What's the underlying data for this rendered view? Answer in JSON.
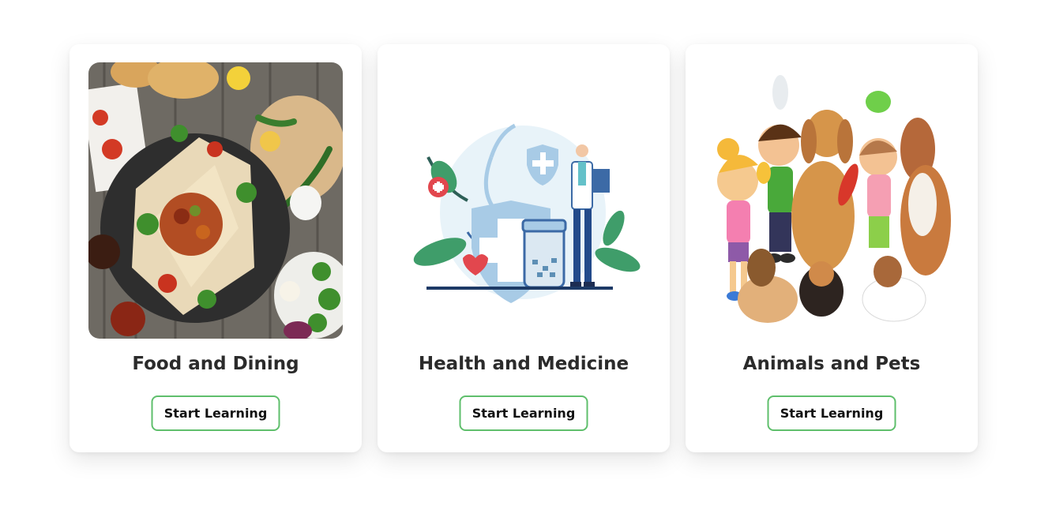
{
  "cards": [
    {
      "title": "Food and Dining",
      "button_label": "Start Learning",
      "image": "food-platter-image"
    },
    {
      "title": "Health and Medicine",
      "button_label": "Start Learning",
      "image": "health-medicine-illustration"
    },
    {
      "title": "Animals and Pets",
      "button_label": "Start Learning",
      "image": "children-with-pets-illustration"
    }
  ],
  "colors": {
    "button_border": "#5fbf6c",
    "title_text": "#2b2b2b",
    "card_background": "#ffffff"
  }
}
